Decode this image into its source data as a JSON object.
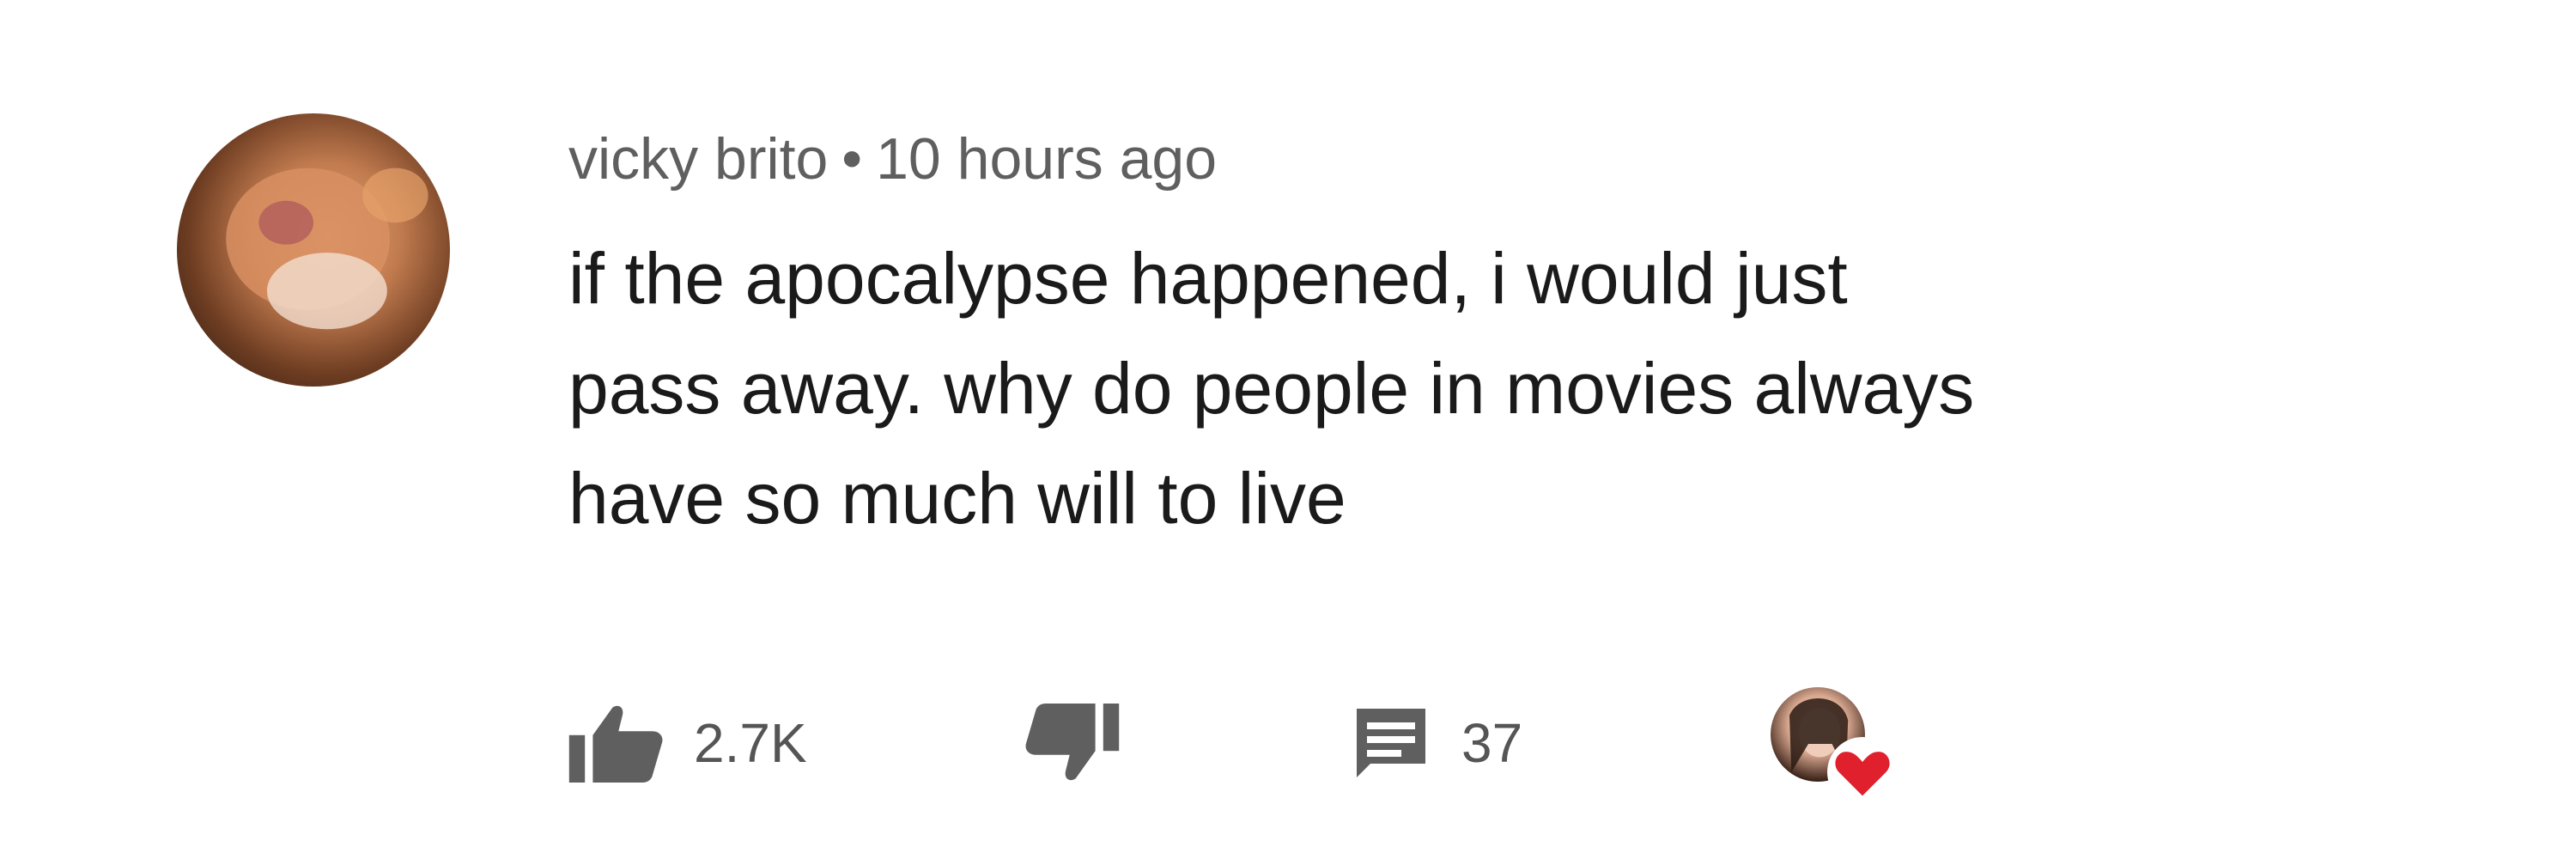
{
  "comment": {
    "author": "vicky brito",
    "separator": "•",
    "timestamp": "10 hours ago",
    "text_lines": [
      "if the apocalypse happened, i would just",
      "pass away. why do people in movies always",
      "have so much will to live"
    ],
    "likes": "2.7K",
    "replies": "37"
  },
  "icons": {
    "like": "thumb-up-icon",
    "dislike": "thumb-down-icon",
    "reply": "comment-icon",
    "creator_heart": "heart-icon"
  },
  "colors": {
    "icon": "#5f5f5f",
    "heart": "#e0202c",
    "meta_text": "#5f5f5f"
  }
}
